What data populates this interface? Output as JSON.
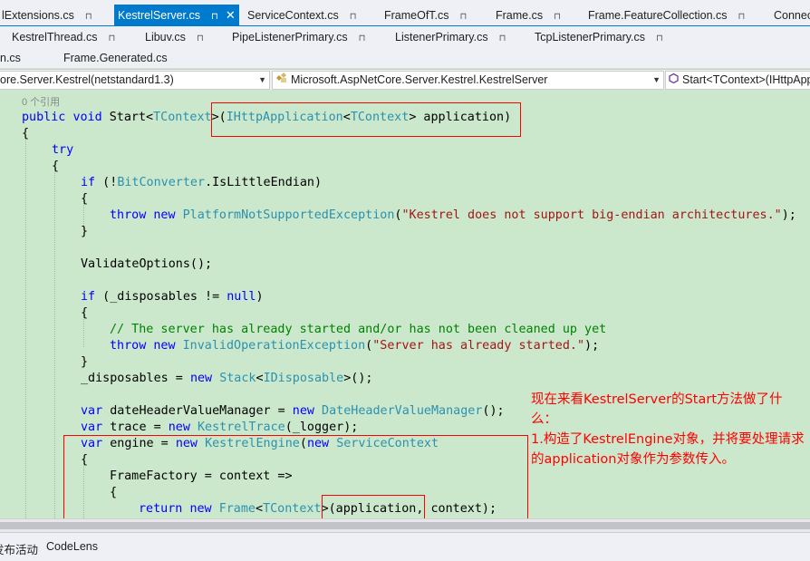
{
  "tabs_row1": [
    {
      "label": "lExtensions.cs",
      "pinned": true
    },
    {
      "label": "KestrelServer.cs",
      "pinned": true,
      "active": true
    },
    {
      "label": "ServiceContext.cs",
      "pinned": true
    },
    {
      "label": "FrameOfT.cs",
      "pinned": true
    },
    {
      "label": "Frame.cs",
      "pinned": true
    },
    {
      "label": "Frame.FeatureCollection.cs",
      "pinned": true
    },
    {
      "label": "Connec",
      "pinned": false
    }
  ],
  "tabs_row2": [
    {
      "label": "KestrelThread.cs",
      "pinned": true
    },
    {
      "label": "Libuv.cs",
      "pinned": true
    },
    {
      "label": "PipeListenerPrimary.cs",
      "pinned": true
    },
    {
      "label": "ListenerPrimary.cs",
      "pinned": true
    },
    {
      "label": "TcpListenerPrimary.cs",
      "pinned": true
    }
  ],
  "tabs_row3": [
    {
      "label": "n.cs"
    },
    {
      "label": "Frame.Generated.cs"
    }
  ],
  "pin_glyph": "⊓",
  "close_glyph": "✕",
  "navbar": {
    "project": "ore.Server.Kestrel(netstandard1.3)",
    "class": "Microsoft.AspNetCore.Server.Kestrel.KestrelServer",
    "member": "Start<TContext>(IHttpAppli",
    "class_icon": "class-icon",
    "member_icon": "method-icon",
    "dropdown_glyph": "▼"
  },
  "codelens_refs": "0 个引用",
  "code": {
    "l_sig": {
      "kw1": "public",
      "kw2": "void",
      "name": " Start<",
      "tctx": "TContext",
      "gt": ">(",
      "iface": "IHttpApplication",
      "lt": "<",
      "tctx2": "TContext",
      "rest": "> application)"
    },
    "l_open1": "{",
    "l_try": "try",
    "l_open2": "{",
    "l_if1": {
      "kw": "if",
      "a": " (!",
      "ty": "BitConverter",
      "b": ".IsLittleEndian)"
    },
    "l_open3": "{",
    "l_throw1": {
      "kw1": "throw",
      "kw2": "new",
      "ty": "PlatformNotSupportedException",
      "a": "(",
      "st": "\"Kestrel does not support big-endian architectures.\"",
      "b": ");"
    },
    "l_close3": "}",
    "l_validate": "ValidateOptions();",
    "l_if2": {
      "kw": "if",
      "a": " (_disposables != ",
      "kw2": "null",
      "b": ")"
    },
    "l_open4": "{",
    "l_comment": "// The server has already started and/or has not been cleaned up yet",
    "l_throw2": {
      "kw1": "throw",
      "kw2": "new",
      "ty": "InvalidOperationException",
      "a": "(",
      "st": "\"Server has already started.\"",
      "b": ");"
    },
    "l_close4": "}",
    "l_disposables": {
      "a": "_disposables = ",
      "kw": "new",
      "ty": "Stack",
      "b": "<",
      "ty2": "IDisposable",
      "c": ">();"
    },
    "l_var1": {
      "kw": "var",
      "a": " dateHeaderValueManager = ",
      "kw2": "new",
      "ty": "DateHeaderValueManager",
      "b": "();"
    },
    "l_var2": {
      "kw": "var",
      "a": " trace = ",
      "kw2": "new",
      "ty": "KestrelTrace",
      "b": "(_logger);"
    },
    "l_var3": {
      "kw": "var",
      "a": " engine = ",
      "kw2": "new",
      "ty": "KestrelEngine",
      "b": "(",
      "kw3": "new",
      "ty2": "ServiceContext"
    },
    "l_open5": "{",
    "l_factory": "FrameFactory = context =>",
    "l_open6": "{",
    "l_return": {
      "kw": "return",
      "kw2": "new",
      "ty": "Frame",
      "a": "<",
      "ty2": "TContext",
      "b": ">(application, context);"
    }
  },
  "annotation": {
    "line1": "现在来看KestrelServer的Start方法做了什么：",
    "line2": "1.构造了KestrelEngine对象，并将要处理请求的application对象作为参数传入。"
  },
  "bottom_tabs": [
    "发布活动",
    "CodeLens"
  ]
}
